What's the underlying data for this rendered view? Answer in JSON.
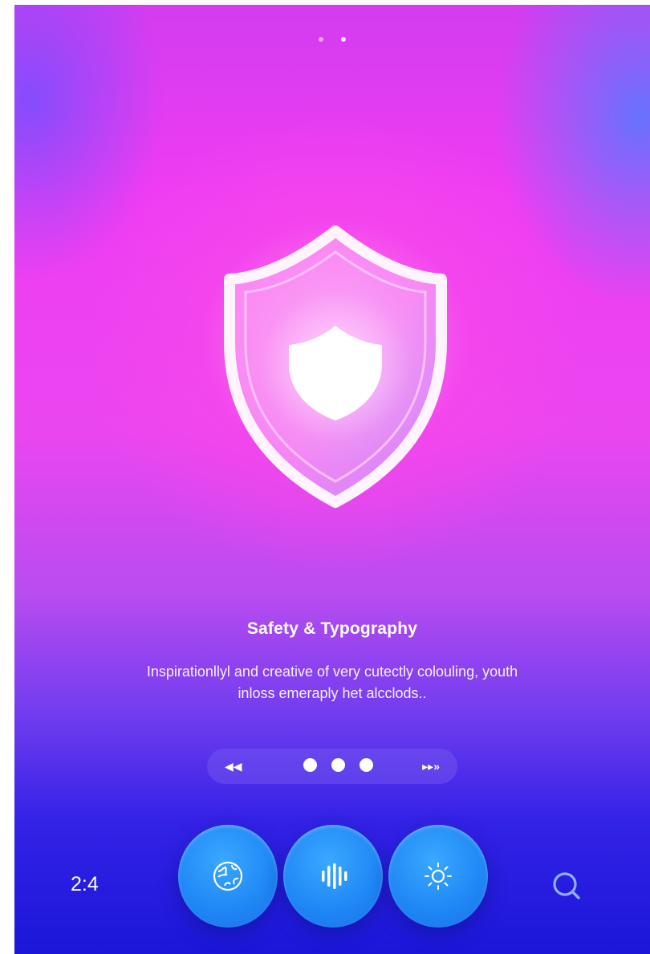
{
  "onboarding": {
    "title": "Safety & Typography",
    "description": "Inspirationllyl and creative of very cutectly colouling, youth inloss emeraply het alcclods..",
    "page_indicator_top": {
      "count": 2,
      "active_index": 1
    },
    "pager": {
      "prev_icon": "rewind-icon",
      "next_icon": "fast-forward-icon",
      "prev_glyph": "◀◀",
      "next_glyph": "▸▸»",
      "dot_count": 3
    }
  },
  "bottom_bar": {
    "time": "2:4",
    "buttons": [
      {
        "icon": "globe-icon"
      },
      {
        "icon": "soundwave-icon"
      },
      {
        "icon": "settings-sun-icon"
      }
    ],
    "search_icon": "search-icon"
  },
  "colors": {
    "accent_button": "#1f86f5",
    "background_top": "#ef3cf2",
    "background_bottom": "#1a17d8"
  }
}
